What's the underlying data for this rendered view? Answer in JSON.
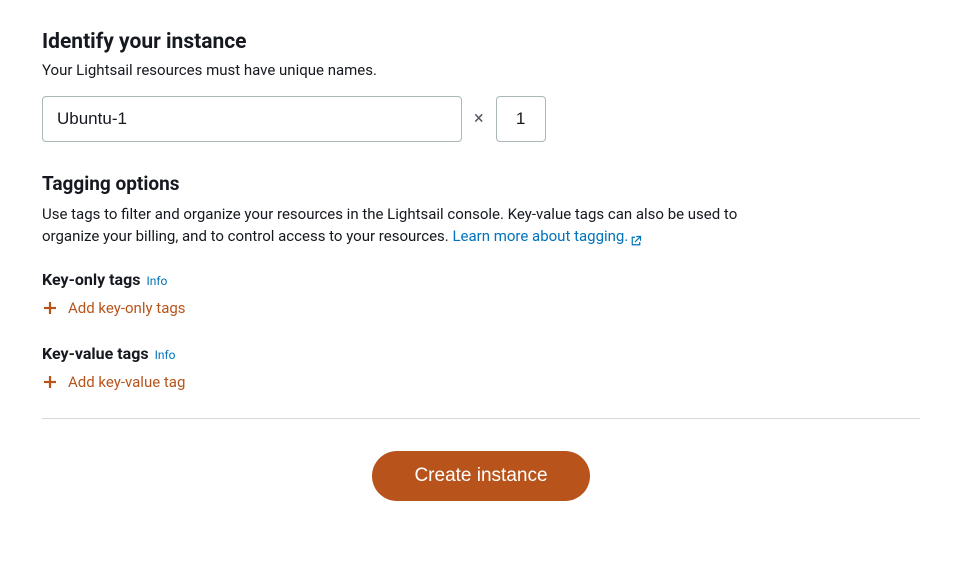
{
  "identify": {
    "heading": "Identify your instance",
    "subtext": "Your Lightsail resources must have unique names.",
    "name_value": "Ubuntu-1",
    "multiply_symbol": "×",
    "qty_value": "1"
  },
  "tagging": {
    "heading": "Tagging options",
    "desc_part1": "Use tags to filter and organize your resources in the Lightsail console. Key-value tags can also be used to organize your billing, and to control access to your resources. ",
    "learn_more_label": "Learn more about tagging."
  },
  "key_only": {
    "heading": "Key-only tags",
    "info": "Info",
    "add_label": "Add key-only tags"
  },
  "key_value": {
    "heading": "Key-value tags",
    "info": "Info",
    "add_label": "Add key-value tag"
  },
  "create_button_label": "Create instance"
}
